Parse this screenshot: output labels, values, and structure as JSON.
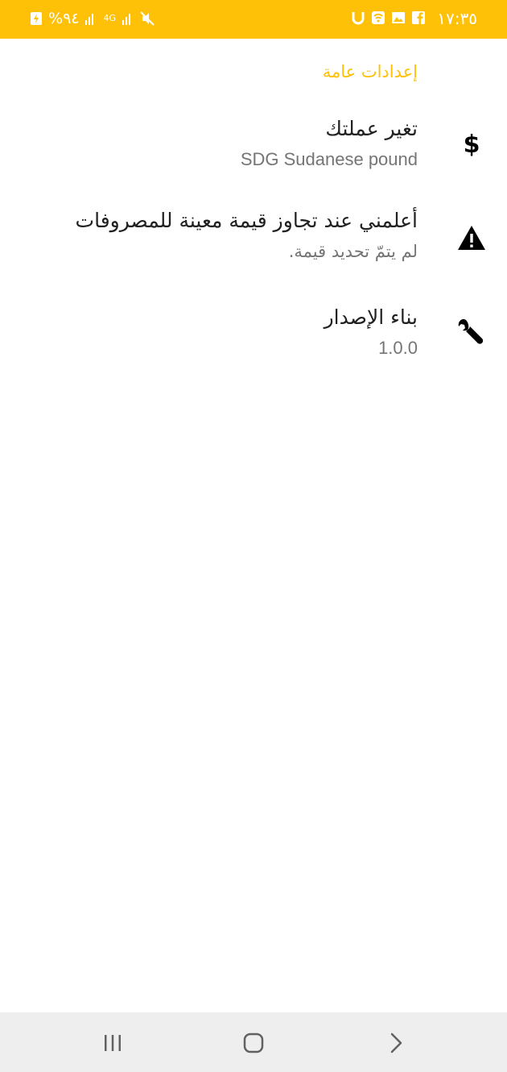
{
  "status_bar": {
    "time": "١٧:٣٥",
    "battery_text": "%٩٤",
    "network_label": "4G",
    "icons": [
      "facebook-icon",
      "gallery-icon",
      "wifi-hotspot-icon",
      "u-app-icon",
      "mute-icon",
      "signal-icon",
      "signal-icon",
      "battery-charging-icon"
    ]
  },
  "settings": {
    "section_title": "إعدادات عامة",
    "items": [
      {
        "title": "تغير عملتك",
        "summary": "SDG Sudanese pound",
        "icon": "dollar-icon"
      },
      {
        "title": "أعلمني عند تجاوز قيمة معينة للمصروفات",
        "summary": "لم يتمّ تحديد قيمة.",
        "icon": "warning-icon"
      },
      {
        "title": "بناء الإصدار",
        "summary": "1.0.0",
        "icon": "wrench-icon"
      }
    ]
  },
  "nav_bar": {
    "buttons": [
      "recents-button",
      "home-button",
      "back-button"
    ]
  },
  "colors": {
    "accent": "#ffc107",
    "title_text": "#212121",
    "summary_text": "#757575",
    "nav_background": "#eeeeee"
  }
}
